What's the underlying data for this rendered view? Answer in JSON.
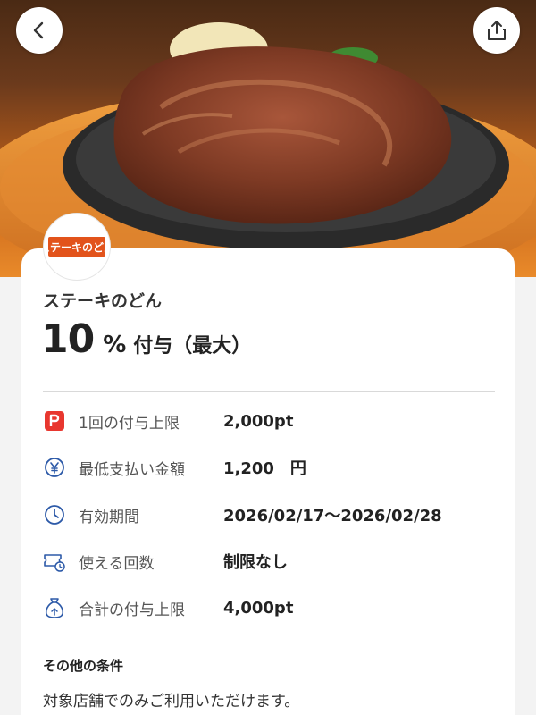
{
  "header": {
    "back_icon": "chevron-left-icon",
    "share_icon": "share-icon",
    "hero_image": "sizzling-steak-on-iron-plate"
  },
  "store": {
    "logo_text": "ステーキのどん",
    "name": "ステーキのどん",
    "logo_color": "#e2531b"
  },
  "reward": {
    "number": "10",
    "unit": "%",
    "suffix": "付与（最大）"
  },
  "details": [
    {
      "icon": "paypay-icon",
      "label": "1回の付与上限",
      "value": "2,000pt"
    },
    {
      "icon": "yen-icon",
      "label": "最低支払い金額",
      "value": "1,200　円"
    },
    {
      "icon": "clock-icon",
      "label": "有効期間",
      "value": "2026/02/17〜2026/02/28"
    },
    {
      "icon": "ticket-icon",
      "label": "使える回数",
      "value": "制限なし"
    },
    {
      "icon": "bag-icon",
      "label": "合計の付与上限",
      "value": "4,000pt"
    }
  ],
  "conditions": {
    "title": "その他の条件",
    "text": "対象店舗でのみご利用いただけます。"
  },
  "colors": {
    "accent": "#e8372f",
    "icon_blue": "#2d5aa8"
  }
}
